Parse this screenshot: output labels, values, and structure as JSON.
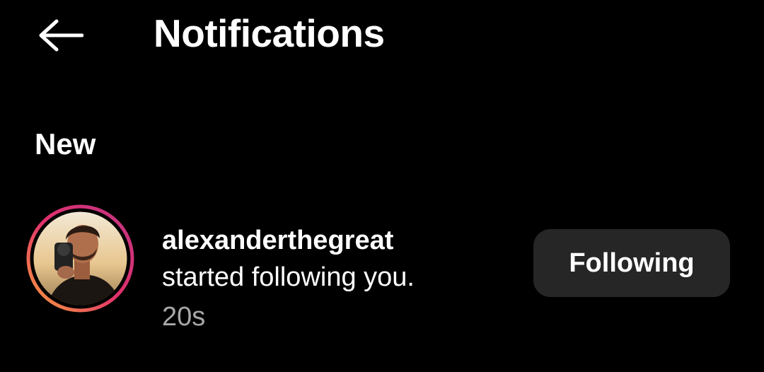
{
  "header": {
    "back_icon": "arrow-left-icon",
    "title": "Notifications"
  },
  "sections": [
    {
      "label": "New",
      "items": [
        {
          "username": "alexanderthegreat",
          "message": "started following you.",
          "time": "20s",
          "button_label": "Following",
          "avatar_icon": "story-ring-avatar"
        }
      ]
    }
  ],
  "colors": {
    "background": "#000000",
    "text": "#ffffff",
    "secondary_text": "#a8a8a8",
    "button_bg": "#262626",
    "story_ring_start": "#f9a33a",
    "story_ring_mid": "#e1306c",
    "story_ring_end": "#c13584"
  }
}
